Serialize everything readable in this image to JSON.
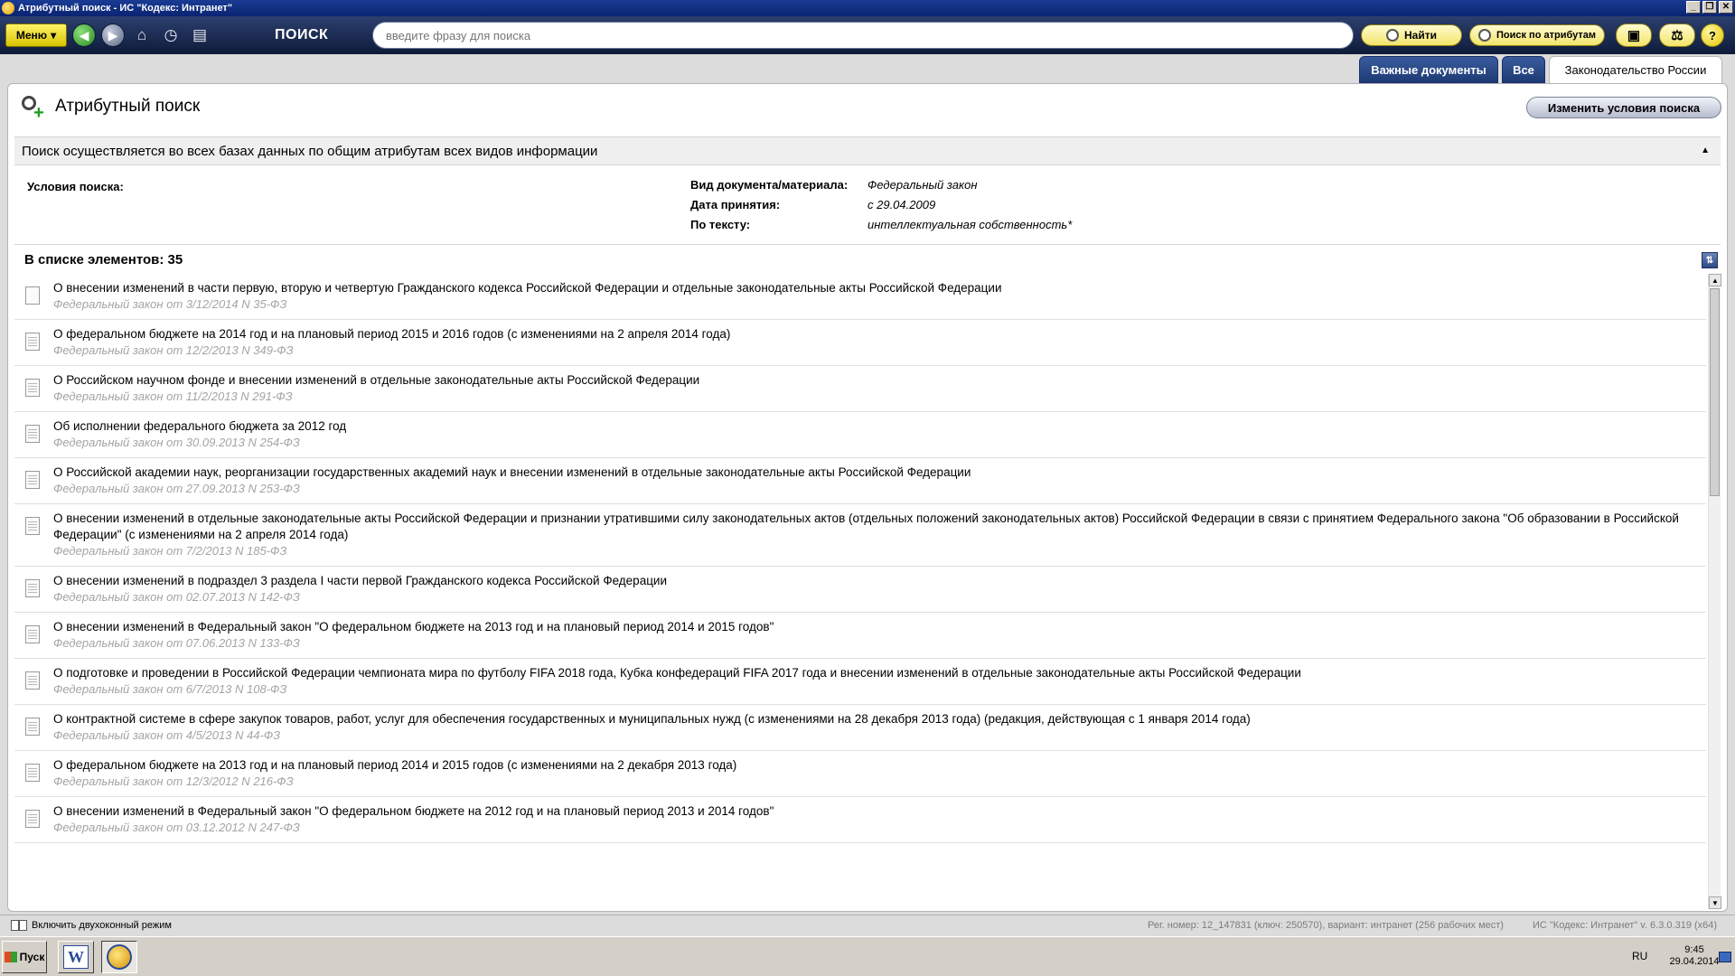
{
  "window": {
    "title": "Атрибутный поиск - ИС \"Кодекс: Интранет\""
  },
  "toolbar": {
    "menu_label": "Меню",
    "search_label": "ПОИСК",
    "search_placeholder": "введите фразу для поиска",
    "find_label": "Найти",
    "attr_search_label": "Поиск по атрибутам"
  },
  "tabs": [
    {
      "label": "Важные документы",
      "active": false
    },
    {
      "label": "Все",
      "active": false
    },
    {
      "label": "Законодательство России",
      "active": true
    }
  ],
  "page": {
    "title": "Атрибутный поиск",
    "change_button": "Изменить условия поиска",
    "info": "Поиск осуществляется во всех базах данных по общим атрибутам всех видов информации"
  },
  "conditions": {
    "label": "Условия поиска:",
    "rows": [
      {
        "key": "Вид документа/материала:",
        "value": "Федеральный закон"
      },
      {
        "key": "Дата принятия:",
        "value": "с 29.04.2009"
      },
      {
        "key": "По тексту:",
        "value": "интеллектуальная собственность*"
      }
    ]
  },
  "list": {
    "count_label": "В списке элементов: 35",
    "items": [
      {
        "title": "О внесении изменений в части первую, вторую и четвертую Гражданского кодекса Российской Федерации и отдельные законодательные акты Российской Федерации",
        "sub": "Федеральный закон от 3/12/2014 N 35-ФЗ"
      },
      {
        "title": "О федеральном бюджете на 2014 год и на плановый период 2015 и 2016 годов (с изменениями на 2 апреля 2014 года)",
        "sub": "Федеральный закон от 12/2/2013 N 349-ФЗ"
      },
      {
        "title": "О Российском научном фонде и внесении изменений в отдельные законодательные акты Российской Федерации",
        "sub": "Федеральный закон от 11/2/2013 N 291-ФЗ"
      },
      {
        "title": "Об исполнении федерального бюджета за 2012 год",
        "sub": "Федеральный закон от 30.09.2013 N 254-ФЗ"
      },
      {
        "title": "О Российской академии наук, реорганизации государственных академий наук и внесении изменений в отдельные законодательные акты Российской Федерации",
        "sub": "Федеральный закон от 27.09.2013 N 253-ФЗ"
      },
      {
        "title": "О внесении изменений в отдельные законодательные акты Российской Федерации и признании утратившими силу законодательных актов (отдельных положений законодательных актов) Российской Федерации в связи с принятием Федерального закона \"Об образовании в Российской Федерации\" (с изменениями на 2 апреля 2014 года)",
        "sub": "Федеральный закон от 7/2/2013 N 185-ФЗ"
      },
      {
        "title": "О внесении изменений в подраздел 3 раздела I части первой Гражданского кодекса Российской Федерации",
        "sub": "Федеральный закон от 02.07.2013 N 142-ФЗ"
      },
      {
        "title": "О внесении изменений в Федеральный закон \"О федеральном бюджете на 2013 год и на плановый период 2014 и 2015 годов\"",
        "sub": "Федеральный закон от 07.06.2013 N 133-ФЗ"
      },
      {
        "title": "О подготовке и проведении в Российской Федерации чемпионата мира по футболу FIFA 2018 года, Кубка конфедераций FIFA 2017 года и внесении изменений в отдельные законодательные акты Российской Федерации",
        "sub": "Федеральный закон от 6/7/2013 N 108-ФЗ"
      },
      {
        "title": "О контрактной системе в сфере закупок товаров, работ, услуг для обеспечения государственных и муниципальных нужд (с изменениями на 28 декабря 2013 года) (редакция, действующая с 1 января 2014 года)",
        "sub": "Федеральный закон от 4/5/2013 N 44-ФЗ"
      },
      {
        "title": "О федеральном бюджете на 2013 год и на плановый период 2014 и 2015 годов (с изменениями на 2 декабря 2013 года)",
        "sub": "Федеральный закон от 12/3/2012 N 216-ФЗ"
      },
      {
        "title": "О внесении изменений в Федеральный закон \"О федеральном бюджете на 2012 год и на плановый период 2013 и 2014 годов\"",
        "sub": "Федеральный закон от 03.12.2012 N 247-ФЗ"
      }
    ]
  },
  "status": {
    "two_window": "Включить двухоконный режим",
    "reg": "Рег. номер: 12_147831 (ключ: 250570), вариант: интранет (256 рабочих мест)",
    "version": "ИС \"Кодекс: Интранет\" v. 6.3.0.319 (x64)"
  },
  "taskbar": {
    "start_label": "Пуск",
    "word_letter": "W",
    "lang": "RU",
    "time": "9:45",
    "date": "29.04.2014"
  }
}
